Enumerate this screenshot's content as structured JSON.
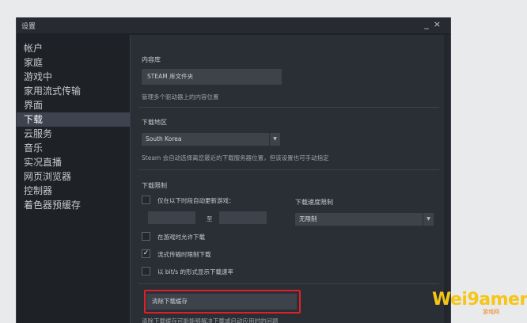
{
  "window": {
    "title": "设置",
    "controls": "_×"
  },
  "sidebar": {
    "items": [
      {
        "label": "帐户",
        "active": false
      },
      {
        "label": "家庭",
        "active": false
      },
      {
        "label": "游戏中",
        "active": false
      },
      {
        "label": "家用流式传输",
        "active": false
      },
      {
        "label": "界面",
        "active": false
      },
      {
        "label": "下载",
        "active": true
      },
      {
        "label": "云服务",
        "active": false
      },
      {
        "label": "音乐",
        "active": false
      },
      {
        "label": "实况直播",
        "active": false
      },
      {
        "label": "网页浏览器",
        "active": false
      },
      {
        "label": "控制器",
        "active": false
      },
      {
        "label": "着色器预缓存",
        "active": false
      }
    ]
  },
  "library": {
    "title": "内容库",
    "button_label": "STEAM 库文件夹",
    "description": "管理多个驱动器上的内容位置"
  },
  "region": {
    "title": "下载地区",
    "selected": "South Korea",
    "caret": "▼",
    "description": "Steam 会自动选择离您最近的下载服务器位置，但该设置也可手动指定"
  },
  "limits": {
    "title": "下载限制",
    "schedule_label": "仅在以下时段自动更新游戏：",
    "to_label": "至",
    "speed_title": "下载速度限制",
    "speed_selected": "无限制",
    "speed_caret": "▼",
    "allow_during_game": "在游戏时允许下载",
    "throttle_streaming": "流式传输时限制下载",
    "show_bits": "以 bit/s 的形式显示下载速率",
    "check_mark": "✓"
  },
  "cache": {
    "button_label": "清除下载缓存",
    "description": "清除下载缓存可能能够解决下载或启动应用时的问题"
  },
  "watermark": {
    "main": "Wei9amer",
    "sub": "游戏网"
  },
  "colors": {
    "highlight": "#e21f26",
    "active_nav": "#3d4450",
    "watermark": "#f5c518"
  }
}
